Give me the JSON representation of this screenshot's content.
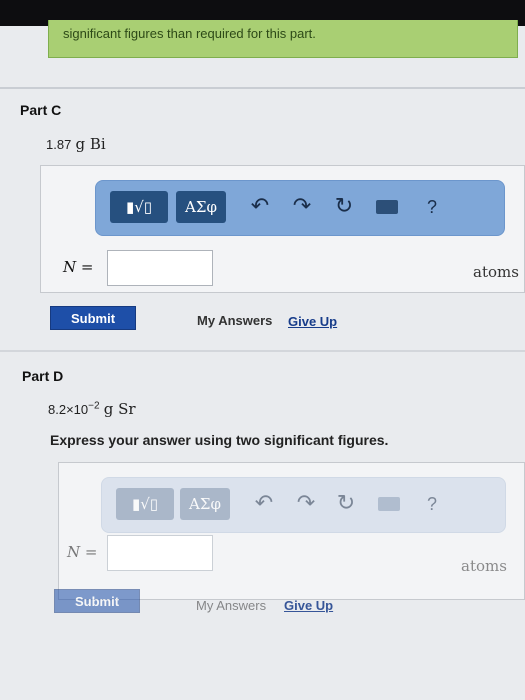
{
  "banner": {
    "text": "significant figures than required for this part."
  },
  "partC": {
    "title": "Part C",
    "quantity": "1.87",
    "unit": "g Bi",
    "toolbar": {
      "templates_label": "▮√▯",
      "symbols_label": "ΑΣφ",
      "help_label": "?"
    },
    "variable_label": "N =",
    "answer_value": "",
    "units_label": "atoms",
    "submit_label": "Submit",
    "my_answers_label": "My Answers",
    "give_up_label": "Give Up"
  },
  "partD": {
    "title": "Part D",
    "quantity_mantissa": "8.2×10",
    "quantity_exponent": "−2",
    "unit": "g Sr",
    "instruction": "Express your answer using two significant figures.",
    "toolbar": {
      "templates_label": "▮√▯",
      "symbols_label": "ΑΣφ",
      "help_label": "?"
    },
    "variable_label": "N =",
    "answer_value": "",
    "units_label": "atoms",
    "submit_label": "Submit",
    "my_answers_label": "My Answers",
    "give_up_label": "Give Up"
  },
  "icons": [
    "undo-icon",
    "redo-icon",
    "reset-icon",
    "keyboard-icon",
    "help-icon"
  ]
}
